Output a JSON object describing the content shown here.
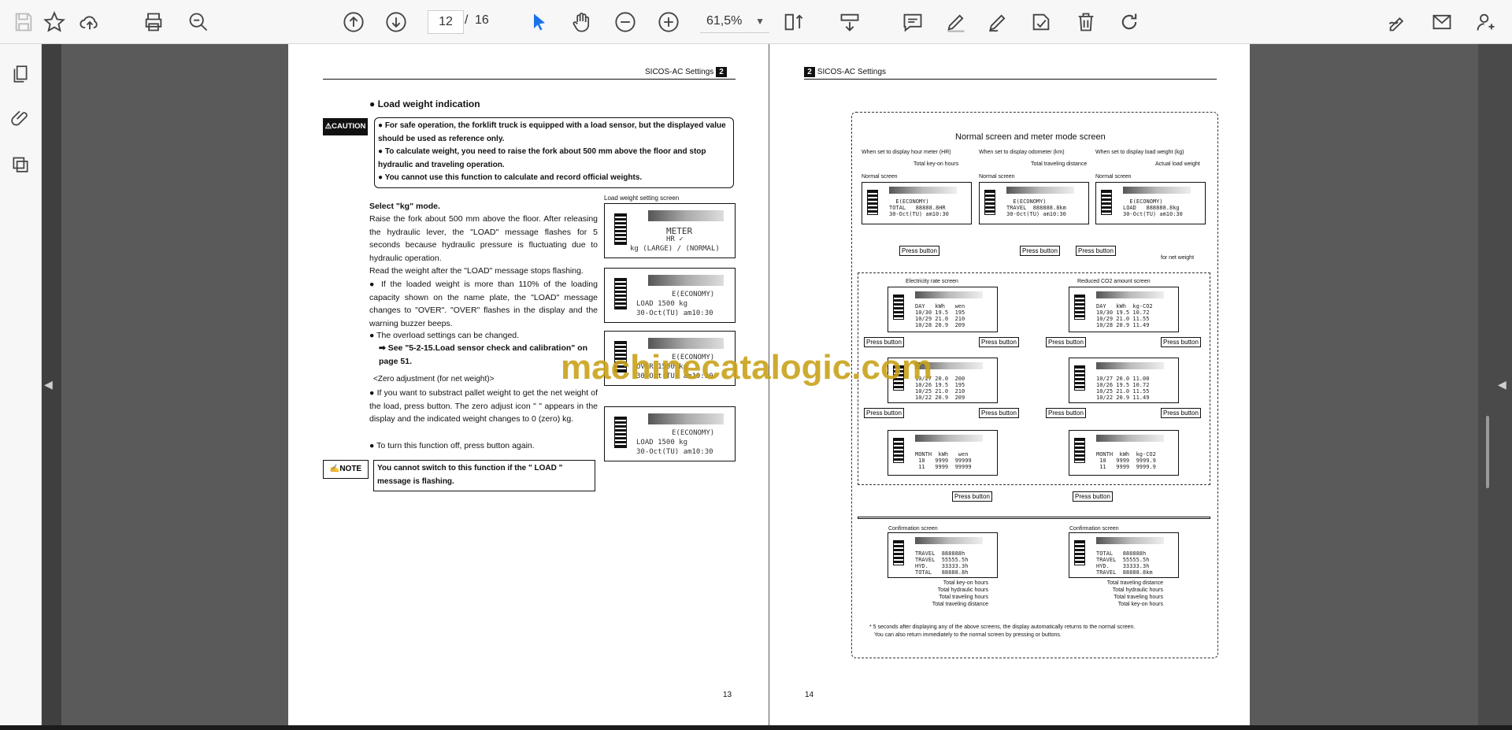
{
  "toolbar": {
    "current_page": "12",
    "page_separator": "/",
    "total_pages": "16",
    "zoom": "61,5%"
  },
  "page13": {
    "header": "SICOS-AC Settings",
    "section": "2",
    "title": "Load weight indication",
    "caution_label": "CAUTION",
    "caution_items": [
      "For safe operation, the forklift truck is equipped with a load sensor, but the displayed value should be used as reference only.",
      "To calculate weight, you need to raise the fork about 500 mm above the floor and stop hydraulic and traveling operation.",
      "You cannot use this function to calculate and record official weights."
    ],
    "select_kg": "Select \"kg\" mode.",
    "para1": "Raise the fork about 500 mm above the floor. After releasing the hydraulic lever, the \"LOAD\" message flashes for 5 seconds because hydraulic pressure is fluctuating due to hydraulic operation.",
    "para2": "Read the weight after the \"LOAD\" message stops flashing.",
    "bullet1": "If the loaded weight is more than 110% of the loading capacity shown on the name plate, the \"LOAD\" message changes to \"OVER\". \"OVER\" flashes in the display and the warning buzzer beeps.",
    "bullet2": "The overload settings can be changed.",
    "see_ref": "See \"5-2-15.Load sensor check and calibration\" on page 51.",
    "zero_title": "<Zero adjustment (for net weight)>",
    "zero1": "If you want to substract pallet weight to get the net weight of the load, press    button. The zero adjust icon \"  \" appears in the display and the indicated weight changes to 0 (zero) kg.",
    "zero2": "To turn this function off, press    button again.",
    "note_label": "NOTE",
    "note_text": "You cannot switch to this function if the \" LOAD \" message is flashing.",
    "screen_title": "Load weight setting screen",
    "lcd1": {
      "l1": "METER",
      "l2": "HR ✓",
      "l3": "kg (LARGE) / (NORMAL)"
    },
    "lcd2": {
      "l1": "E(ECONOMY)",
      "l2": "LOAD      1500 kg",
      "l3": "30-Oct(TU)  am10:30"
    },
    "lcd3": {
      "l1": "E(ECONOMY)",
      "l2": "OVER      1500 kg",
      "l3": "30-Oct(TU)  am10:30"
    },
    "lcd4": {
      "l1": "E(ECONOMY)",
      "l2": "LOAD      1500 kg",
      "l3": "30-Oct(TU)  am10:30"
    },
    "page_number": "13"
  },
  "page14": {
    "header": "SICOS-AC Settings",
    "section": "2",
    "diagram_title": "Normal screen and meter mode screen",
    "col_headers": [
      "When set to display hour meter (HR)",
      "When set to display odometer (km)",
      "When set to display load weight (kg)"
    ],
    "col_labels": [
      "Total key-on hours",
      "Total traveling distance",
      "Actual load weight"
    ],
    "normal_screen": "Normal screen",
    "press_button": "Press button",
    "for_net_weight": "for net weight",
    "electricity_title": "Electricity rate screen",
    "co2_title": "Reduced CO2 amount screen",
    "confirmation_title": "Confirmation screen",
    "left_conf_labels": [
      "Total key-on hours",
      "Total hydraulic hours",
      "Total traveling hours",
      "Total traveling distance"
    ],
    "right_conf_labels": [
      "Total traveling distance",
      "Total hydraulic hours",
      "Total traveling hours",
      "Total key-on hours"
    ],
    "footnote1": "* 5 seconds after displaying any of the above screens, the display automatically returns to the normal screen.",
    "footnote2": "You can also return immediately to the normal screen by pressing   or   buttons.",
    "page_number": "14"
  },
  "watermark": "machinecatalogic.com"
}
